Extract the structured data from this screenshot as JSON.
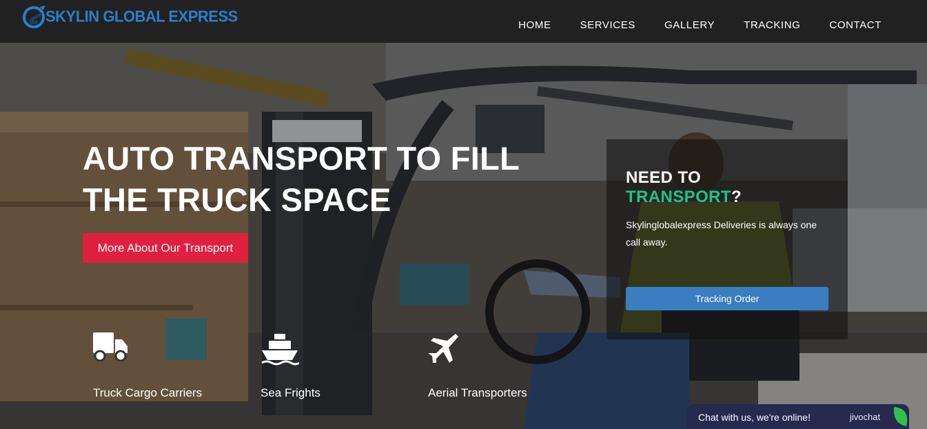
{
  "header": {
    "logo_text": "SKYLIN GLOBAL EXPRESS",
    "nav": [
      "HOME",
      "SERVICES",
      "GALLERY",
      "TRACKING",
      "CONTACT"
    ]
  },
  "hero": {
    "headline_line1": "AUTO TRANSPORT TO FILL",
    "headline_line2": "THE TRUCK SPACE",
    "cta_label": "More About Our Transport",
    "services": [
      {
        "icon": "truck-icon",
        "label": "Truck Cargo Carriers"
      },
      {
        "icon": "ship-icon",
        "label": "Sea Frights"
      },
      {
        "icon": "airplane-icon",
        "label": "Aerial Transporters"
      }
    ]
  },
  "panel": {
    "title_line1": "NEED TO",
    "title_accent": "TRANSPORT",
    "title_suffix": "?",
    "description": "Skylinglobalexpress Deliveries is always one call away.",
    "button_label": "Tracking Order"
  },
  "chat": {
    "text": "Chat with us, we're online!",
    "brand": "jivochat"
  },
  "colors": {
    "header_bg": "#212121",
    "logo_blue": "#2a7fc9",
    "cta_red": "#e0203f",
    "accent_green": "#1fc38a",
    "button_blue": "#3a7dc0",
    "chat_bg": "#262a4e"
  }
}
